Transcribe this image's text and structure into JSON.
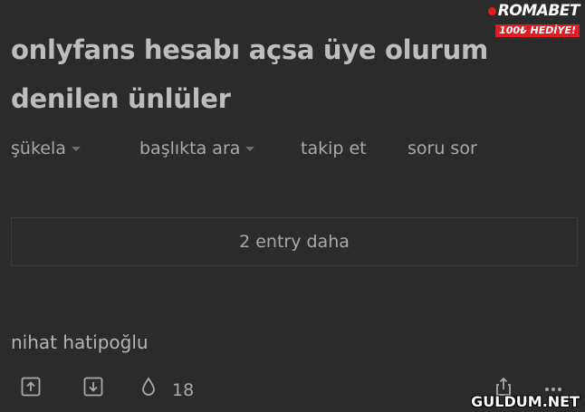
{
  "topic": {
    "title": "onlyfans hesabı açsa üye olurum denilen ünlüler"
  },
  "nav": {
    "items": [
      {
        "label": "şükela",
        "has_dropdown": true
      },
      {
        "label": "başlıkta ara",
        "has_dropdown": true
      },
      {
        "label": "takip et",
        "has_dropdown": false
      },
      {
        "label": "soru sor",
        "has_dropdown": false
      }
    ]
  },
  "more_entries": {
    "label": "2 entry daha"
  },
  "entry": {
    "text": "nihat hatipoğlu",
    "actions": {
      "upvote_icon": "arrow-up-box-icon",
      "downvote_icon": "arrow-down-box-icon",
      "favorite_icon": "drop-icon",
      "favorite_count": "18",
      "share_icon": "share-icon",
      "more_icon": "ellipsis-icon"
    }
  },
  "watermarks": {
    "top_brand": "ROMABET",
    "top_promo": "100₺ HEDİYE!",
    "bottom": "GULDUM.NET"
  },
  "colors": {
    "background": "#2b2b2b",
    "text": "#bdbdbd",
    "muted": "#a9a9a9",
    "border": "#3c3c3c",
    "brand_red": "#e21b23"
  }
}
